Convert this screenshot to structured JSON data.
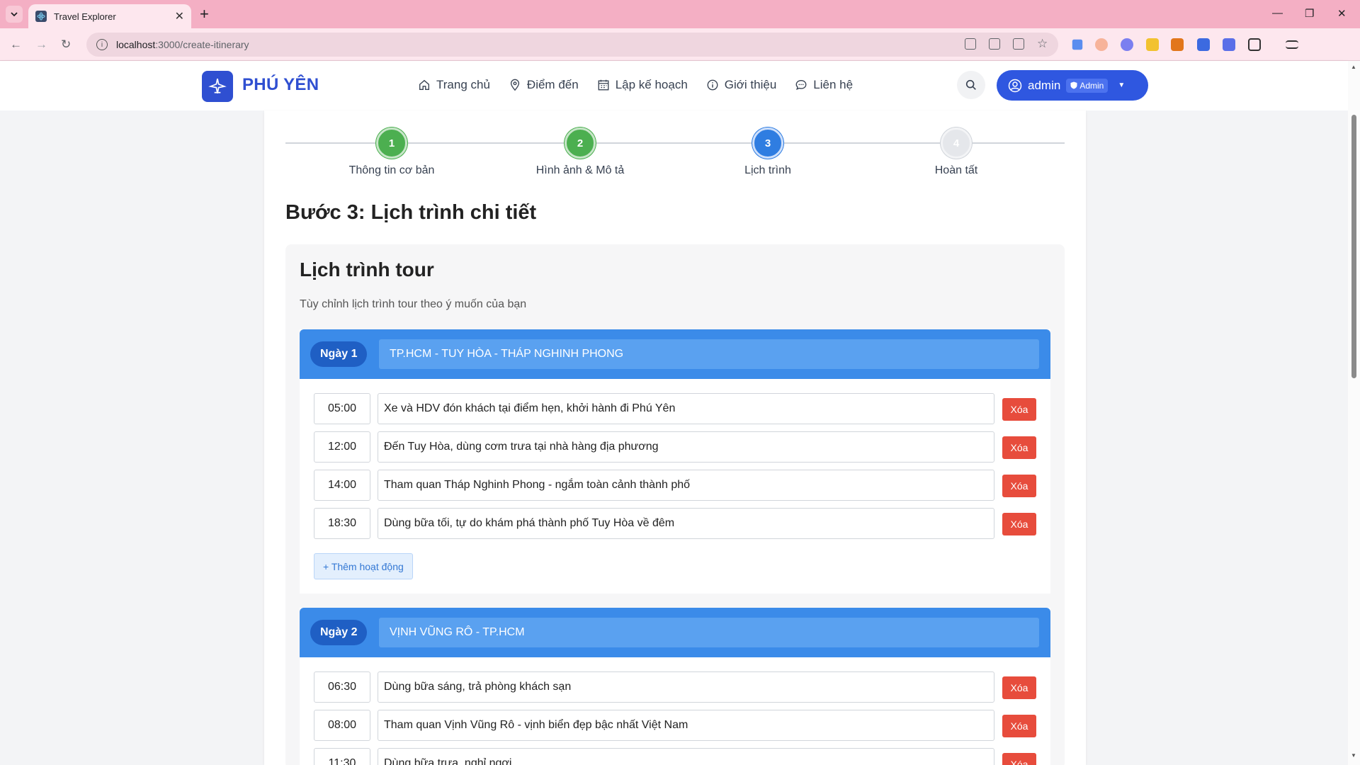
{
  "browser": {
    "tab_title": "Travel Explorer",
    "url_host": "localhost",
    "url_rest": ":3000/create-itinerary"
  },
  "site": {
    "logo_text": "PHÚ YÊN",
    "nav": [
      {
        "label": "Trang chủ",
        "icon": "home-icon"
      },
      {
        "label": "Điểm đến",
        "icon": "map-pin-icon"
      },
      {
        "label": "Lập kế hoạch",
        "icon": "calendar-icon"
      },
      {
        "label": "Giới thiệu",
        "icon": "info-icon"
      },
      {
        "label": "Liên hệ",
        "icon": "chat-icon"
      }
    ],
    "user": {
      "name": "admin",
      "role": "Admin"
    }
  },
  "stepper": {
    "steps": [
      {
        "number": "1",
        "label": "Thông tin cơ bản",
        "state": "done"
      },
      {
        "number": "2",
        "label": "Hình ảnh & Mô tả",
        "state": "done"
      },
      {
        "number": "3",
        "label": "Lịch trình",
        "state": "active"
      },
      {
        "number": "4",
        "label": "Hoàn tất",
        "state": "todo"
      }
    ]
  },
  "main": {
    "step_title": "Bước 3: Lịch trình chi tiết",
    "panel_title": "Lịch trình tour",
    "panel_subtitle": "Tùy chỉnh lịch trình tour theo ý muốn của bạn",
    "delete_label": "Xóa",
    "add_activity_label": "+ Thêm hoạt động",
    "days": [
      {
        "badge": "Ngày 1",
        "title": "TP.HCM - TUY HÒA - THÁP NGHINH PHONG",
        "activities": [
          {
            "time": "05:00",
            "desc": "Xe và HDV đón khách tại điểm hẹn, khởi hành đi Phú Yên"
          },
          {
            "time": "12:00",
            "desc": "Đến Tuy Hòa, dùng cơm trưa tại nhà hàng địa phương"
          },
          {
            "time": "14:00",
            "desc": "Tham quan Tháp Nghinh Phong - ngắm toàn cảnh thành phố"
          },
          {
            "time": "18:30",
            "desc": "Dùng bữa tối, tự do khám phá thành phố Tuy Hòa về đêm"
          }
        ]
      },
      {
        "badge": "Ngày 2",
        "title": "VỊNH VŨNG RÔ - TP.HCM",
        "activities": [
          {
            "time": "06:30",
            "desc": "Dùng bữa sáng, trả phòng khách sạn"
          },
          {
            "time": "08:00",
            "desc": "Tham quan Vịnh Vũng Rô - vịnh biển đẹp bậc nhất Việt Nam"
          },
          {
            "time": "11:30",
            "desc": "Dùng bữa trưa, nghỉ ngơi"
          }
        ]
      }
    ]
  }
}
